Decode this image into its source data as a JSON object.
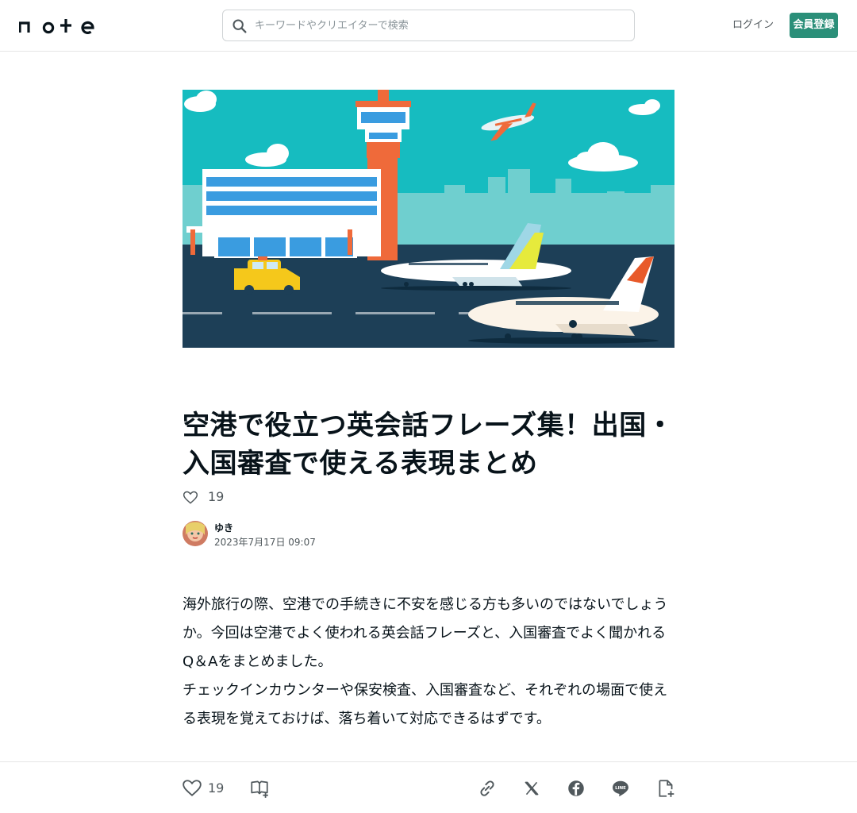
{
  "header": {
    "logo_text": "note",
    "search_placeholder": "キーワードやクリエイターで検索",
    "login_label": "ログイン",
    "signup_label": "会員登録"
  },
  "article": {
    "title": "空港で役立つ英会話フレーズ集！出国・入国審査で使える表現まとめ",
    "like_count": "19",
    "author_name": "ゆき",
    "date": "2023年7月17日 09:07",
    "paragraph1": "海外旅行の際、空港での手続きに不安を感じる方も多いのではないでしょうか。今回は空港でよく使われる英会話フレーズと、入国審査でよく聞かれるQ＆Aをまとめました。",
    "paragraph2": "チェックインカウンターや保安検査、入国審査など、それぞれの場面で使える表現を覚えておけば、落ち着いて対応できるはずです。"
  },
  "action_bar": {
    "like_count": "19"
  },
  "icons": {
    "search": "search-icon",
    "heart": "heart-icon",
    "magazine": "magazine-add-icon",
    "link": "link-icon",
    "x": "x-icon",
    "facebook": "facebook-icon",
    "line": "line-icon",
    "note_add": "note-add-icon"
  },
  "colors": {
    "brand_green": "#2b8f79",
    "text_main": "#08131a",
    "text_sub": "#50585c"
  }
}
